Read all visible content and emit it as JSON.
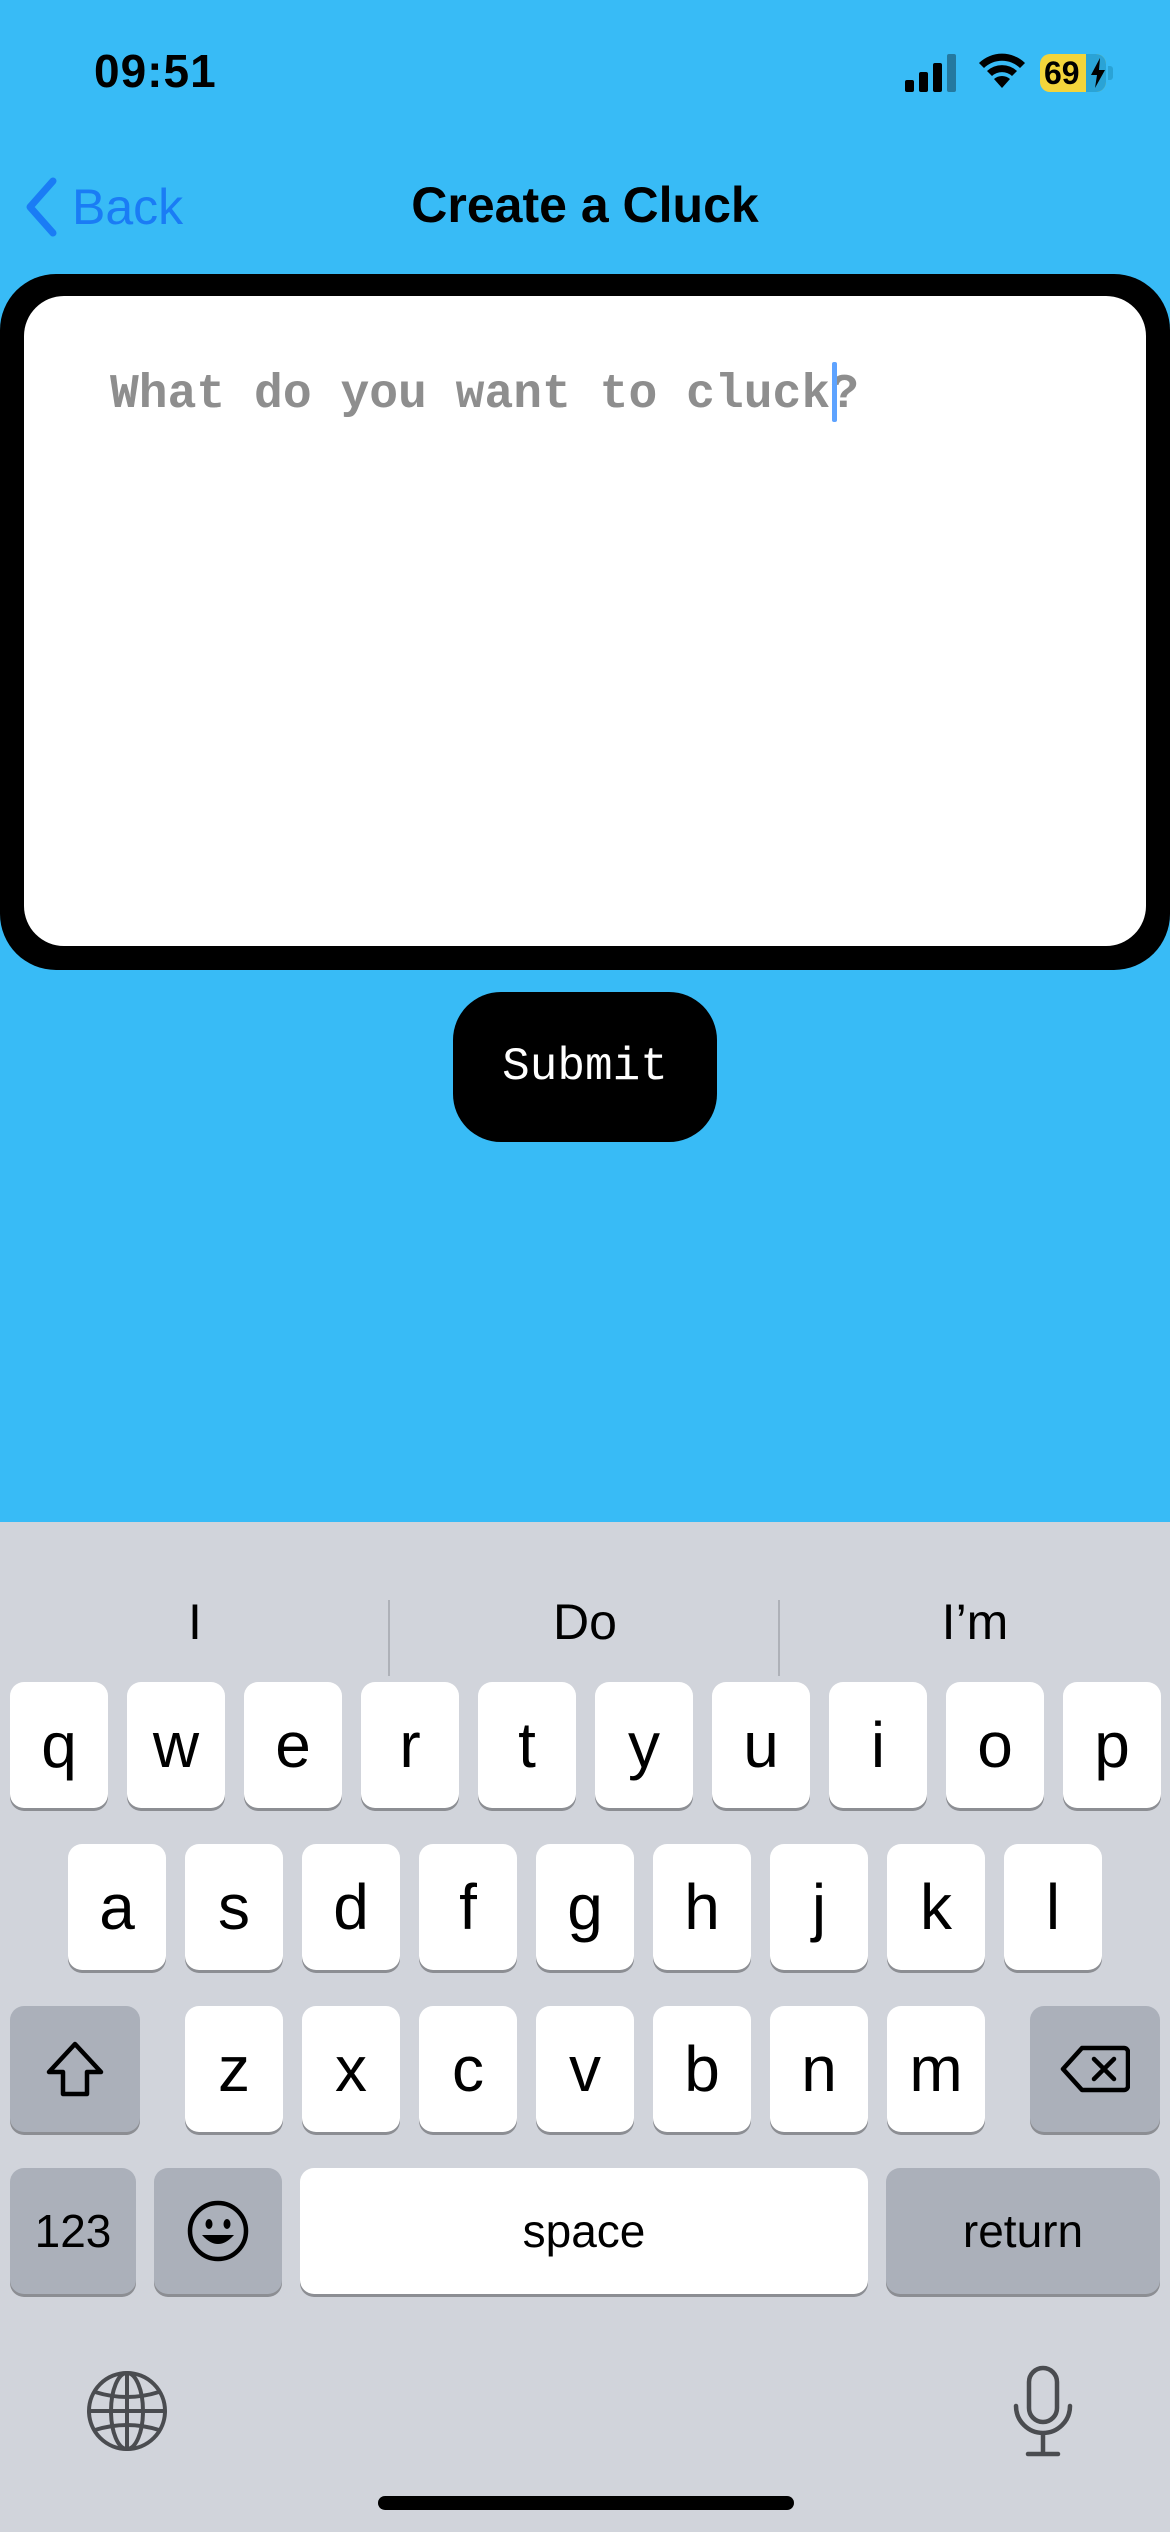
{
  "status": {
    "time": "09:51",
    "battery_level": "69",
    "battery_fraction": 0.69
  },
  "nav": {
    "back_label": "Back",
    "title": "Create a Cluck"
  },
  "editor": {
    "value": "",
    "placeholder": "What do you want to cluck?"
  },
  "submit_label": "Submit",
  "keyboard": {
    "suggestions": [
      "I",
      "Do",
      "I’m"
    ],
    "rows": [
      [
        "q",
        "w",
        "e",
        "r",
        "t",
        "y",
        "u",
        "i",
        "o",
        "p"
      ],
      [
        "a",
        "s",
        "d",
        "f",
        "g",
        "h",
        "j",
        "k",
        "l"
      ],
      [
        "z",
        "x",
        "c",
        "v",
        "b",
        "n",
        "m"
      ]
    ],
    "numbers_label": "123",
    "space_label": "space",
    "return_label": "return"
  },
  "colors": {
    "background": "#38bbf6",
    "accent": "#1a7cf5",
    "battery": "#f3d53b",
    "keyboard": "#d1d4db"
  }
}
